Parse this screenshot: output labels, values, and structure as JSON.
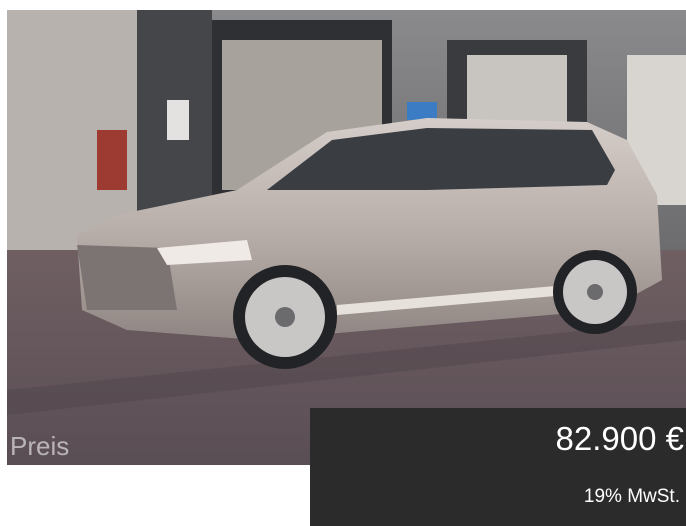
{
  "listing": {
    "photo": {
      "alt": "Silver SUV parked in front of workshop",
      "icon": "car-photo"
    },
    "price_label": "Preis",
    "price_value": "82.900 €",
    "tax_note": "19% MwSt."
  },
  "colors": {
    "panel_background": "#2b2b2b",
    "price_text": "#ffffff",
    "label_text": "#b9b4b6"
  }
}
